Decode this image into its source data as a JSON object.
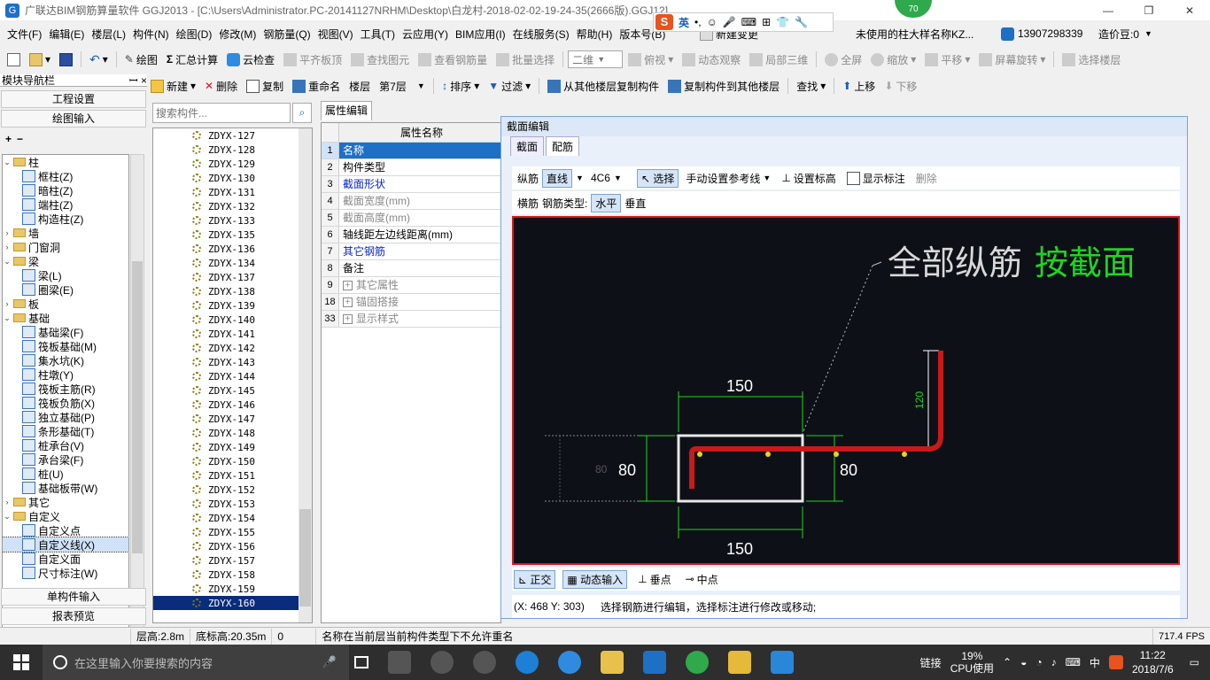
{
  "window": {
    "title": "广联达BIM钢筋算量软件 GGJ2013 - [C:\\Users\\Administrator.PC-20141127NRHM\\Desktop\\白龙村-2018-02-02-19-24-35(2666版).GGJ12]",
    "controls": [
      "—",
      "❐",
      "✕"
    ]
  },
  "ime": {
    "label": "英",
    "score_badge": "70"
  },
  "menu": {
    "items": [
      "文件(F)",
      "编辑(E)",
      "楼层(L)",
      "构件(N)",
      "绘图(D)",
      "修改(M)",
      "钢筋量(Q)",
      "视图(V)",
      "工具(T)",
      "云应用(Y)",
      "BIM应用(I)",
      "在线服务(S)",
      "帮助(H)",
      "版本号(B)"
    ],
    "new_change": "新建变更",
    "notice": "未使用的柱大样名称KZ...",
    "user": "13907298339",
    "points": "造价豆:0"
  },
  "toolbar1": {
    "draw": "绘图",
    "sum": "汇总计算",
    "cloud_check": "云检查",
    "align_slab": "平齐板顶",
    "find_elem": "查找图元",
    "view_rebar": "查看钢筋量",
    "batch_select": "批量选择",
    "view_mode": "二维",
    "top_view": "俯视",
    "dynamic": "动态观察",
    "local3d": "局部三维",
    "fullscreen": "全屏",
    "zoom": "缩放",
    "pan": "平移",
    "rotate": "屏幕旋转",
    "select_floor": "选择楼层"
  },
  "toolbar2": {
    "new": "新建",
    "delete": "删除",
    "copy": "复制",
    "rename": "重命名",
    "floor_label": "楼层",
    "floor_value": "第7层",
    "sort": "排序",
    "filter": "过滤",
    "copy_from": "从其他楼层复制构件",
    "copy_to": "复制构件到其他楼层",
    "find": "查找",
    "move_up": "上移",
    "move_down": "下移"
  },
  "nav": {
    "title": "模块导航栏",
    "pin": "ꟷ ×",
    "project_settings": "工程设置",
    "draw_input": "绘图输入",
    "tree": [
      {
        "label": "柱",
        "level": 0,
        "exp": "⌄"
      },
      {
        "label": "框柱(Z)",
        "level": 1
      },
      {
        "label": "暗柱(Z)",
        "level": 1
      },
      {
        "label": "端柱(Z)",
        "level": 1
      },
      {
        "label": "构造柱(Z)",
        "level": 1
      },
      {
        "label": "墙",
        "level": 0,
        "exp": "›"
      },
      {
        "label": "门窗洞",
        "level": 0,
        "exp": "›"
      },
      {
        "label": "梁",
        "level": 0,
        "exp": "⌄"
      },
      {
        "label": "梁(L)",
        "level": 1
      },
      {
        "label": "圈梁(E)",
        "level": 1
      },
      {
        "label": "板",
        "level": 0,
        "exp": "›"
      },
      {
        "label": "基础",
        "level": 0,
        "exp": "⌄"
      },
      {
        "label": "基础梁(F)",
        "level": 1
      },
      {
        "label": "筏板基础(M)",
        "level": 1
      },
      {
        "label": "集水坑(K)",
        "level": 1
      },
      {
        "label": "柱墩(Y)",
        "level": 1
      },
      {
        "label": "筏板主筋(R)",
        "level": 1
      },
      {
        "label": "筏板负筋(X)",
        "level": 1
      },
      {
        "label": "独立基础(P)",
        "level": 1
      },
      {
        "label": "条形基础(T)",
        "level": 1
      },
      {
        "label": "桩承台(V)",
        "level": 1
      },
      {
        "label": "承台梁(F)",
        "level": 1
      },
      {
        "label": "桩(U)",
        "level": 1
      },
      {
        "label": "基础板带(W)",
        "level": 1
      },
      {
        "label": "其它",
        "level": 0,
        "exp": "›"
      },
      {
        "label": "自定义",
        "level": 0,
        "exp": "⌄"
      },
      {
        "label": "自定义点",
        "level": 1
      },
      {
        "label": "自定义线(X)",
        "level": 1,
        "selected": true
      },
      {
        "label": "自定义面",
        "level": 1
      },
      {
        "label": "尺寸标注(W)",
        "level": 1
      }
    ],
    "single_input": "单构件输入",
    "report_preview": "报表预览"
  },
  "components": {
    "search_placeholder": "搜索构件...",
    "items": [
      "ZDYX-127",
      "ZDYX-128",
      "ZDYX-129",
      "ZDYX-130",
      "ZDYX-131",
      "ZDYX-132",
      "ZDYX-133",
      "ZDYX-135",
      "ZDYX-136",
      "ZDYX-134",
      "ZDYX-137",
      "ZDYX-138",
      "ZDYX-139",
      "ZDYX-140",
      "ZDYX-141",
      "ZDYX-142",
      "ZDYX-143",
      "ZDYX-144",
      "ZDYX-145",
      "ZDYX-146",
      "ZDYX-147",
      "ZDYX-148",
      "ZDYX-149",
      "ZDYX-150",
      "ZDYX-151",
      "ZDYX-152",
      "ZDYX-153",
      "ZDYX-154",
      "ZDYX-155",
      "ZDYX-156",
      "ZDYX-157",
      "ZDYX-158",
      "ZDYX-159",
      "ZDYX-160"
    ],
    "selected": "ZDYX-160"
  },
  "props": {
    "tab": "属性编辑",
    "header": "属性名称",
    "rows": [
      {
        "n": "1",
        "label": "名称",
        "style": "sel"
      },
      {
        "n": "2",
        "label": "构件类型",
        "style": ""
      },
      {
        "n": "3",
        "label": "截面形状",
        "style": "blue"
      },
      {
        "n": "4",
        "label": "截面宽度(mm)",
        "style": "gray"
      },
      {
        "n": "5",
        "label": "截面高度(mm)",
        "style": "gray"
      },
      {
        "n": "6",
        "label": "轴线距左边线距离(mm)",
        "style": ""
      },
      {
        "n": "7",
        "label": "其它钢筋",
        "style": "blue"
      },
      {
        "n": "8",
        "label": "备注",
        "style": ""
      },
      {
        "n": "9",
        "label": "其它属性",
        "style": "gray",
        "plus": true
      },
      {
        "n": "18",
        "label": "锚固搭接",
        "style": "gray",
        "plus": true
      },
      {
        "n": "33",
        "label": "显示样式",
        "style": "gray",
        "plus": true
      }
    ]
  },
  "section": {
    "title": "截面编辑",
    "tabs": [
      "截面",
      "配筋"
    ],
    "long_rebar": "纵筋",
    "line_mode": "直线",
    "spec": "4C6",
    "select": "选择",
    "ref_line": "手动设置参考线",
    "set_elev": "设置标高",
    "show_dim": "显示标注",
    "delete": "删除",
    "trans_rebar": "横筋",
    "rebar_type": "钢筋类型:",
    "horizontal": "水平",
    "vertical": "垂直",
    "canvas": {
      "note_white": "全部纵筋",
      "note_green": "按截面",
      "dim_top": "150",
      "dim_bottom": "150",
      "dim_left": "80",
      "dim_right": "80",
      "dim_hook": "120",
      "dim_faint": "80"
    },
    "ortho": "正交",
    "dyn_input": "动态输入",
    "perp": "垂点",
    "mid": "中点",
    "coords": "(X: 468 Y: 303)",
    "hint": "选择钢筋进行编辑，选择标注进行修改或移动;"
  },
  "status": {
    "floor_height": "层高:2.8m",
    "bottom_elev": "底标高:20.35m",
    "zero": "0",
    "message": "名称在当前层当前构件类型下不允许重名",
    "fps": "717.4 FPS"
  },
  "taskbar": {
    "search_placeholder": "在这里输入你要搜索的内容",
    "link": "链接",
    "cpu_pct": "19%",
    "cpu_label": "CPU使用",
    "lang": "中",
    "time": "11:22",
    "date": "2018/7/6"
  }
}
